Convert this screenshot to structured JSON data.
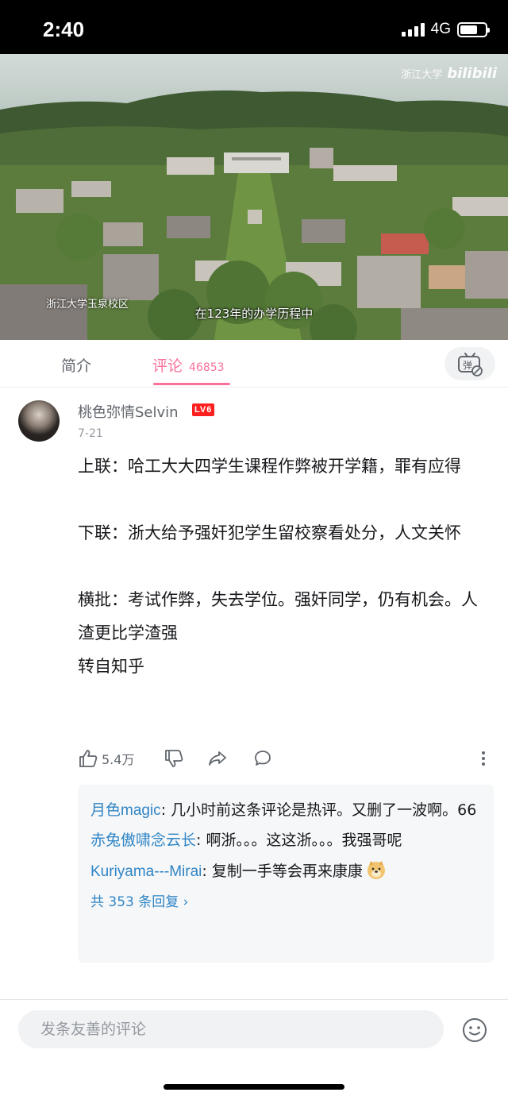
{
  "status": {
    "time": "2:40",
    "network": "4G",
    "battery_level": 0.7
  },
  "video": {
    "watermark_text": "浙江大学",
    "watermark_logo": "bilibili",
    "location": "浙江大学玉泉校区",
    "subtitle": "在123年的办学历程中"
  },
  "tabs": {
    "intro": "简介",
    "comments": "评论",
    "comments_count": "46853",
    "danmaku_icon": "danmaku-off-icon"
  },
  "comment": {
    "username": "桃色弥情Selvin",
    "level": "LV6",
    "date": "7-21",
    "lines": [
      "上联：哈工大大四学生课程作弊被开学籍，罪有应得",
      "下联：浙大给予强奸犯学生留校察看处分，人文关怀",
      "横批：考试作弊，失去学位。强奸同学，仍有机会。人渣更比学渣强",
      "转自知乎"
    ],
    "likes": "5.4万"
  },
  "replies": [
    {
      "user": "月色magic",
      "text": ": 几小时前这条评论是热评。又删了一波啊。66"
    },
    {
      "user": "赤兔傲啸念云长",
      "text": ": 啊浙。。。这这浙。。。我强哥呢"
    },
    {
      "user": "Kuriyama---Mirai",
      "text": ": 复制一手等会再来康康"
    }
  ],
  "replies_more": "共 353 条回复 ›",
  "input": {
    "placeholder": "发条友善的评论"
  },
  "colors": {
    "accent": "#fb7299",
    "link": "#2f85c6",
    "level_badge": "#ff1f1f"
  }
}
